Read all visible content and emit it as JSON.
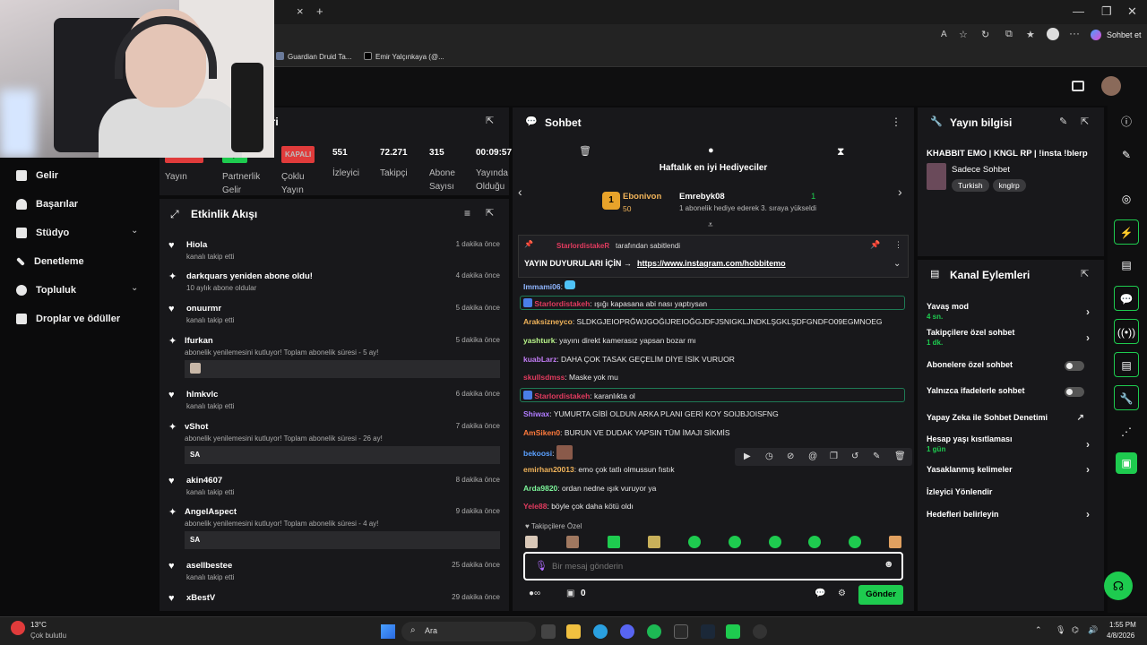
{
  "browser": {
    "tab_close": "×",
    "tab_new": "+",
    "window_controls": [
      "—",
      "❐",
      "✕"
    ],
    "chat_button": "Sohbet et",
    "bookmarks": [
      "Guardian Druid Ta...",
      "Emir Yalçınkaya (@..."
    ]
  },
  "leftnav": {
    "items": [
      "Gelir",
      "Başarılar",
      "Stüdyo",
      "Denetleme",
      "Topluluk",
      "Droplar ve ödüller"
    ]
  },
  "stats": {
    "title_fragment": "eri",
    "badges": [
      {
        "badge": "YAYINDA",
        "label": "Yayın",
        "color": "#e03b3b"
      },
      {
        "badge": "AÇIK",
        "label": "Partnerlik Gelir",
        "color": "#1ecb4f"
      },
      {
        "badge": "KAPALI",
        "label": "Çoklu Yayın",
        "color": "#e03b3b"
      }
    ],
    "numbers": [
      {
        "value": "551",
        "label": "İzleyici"
      },
      {
        "value": "72.271",
        "label": "Takipçi"
      },
      {
        "value": "315",
        "label": "Abone Sayısı"
      },
      {
        "value": "00:09:57",
        "label": "Yayında Olduğu Süre"
      }
    ]
  },
  "feed": {
    "title": "Etkinlik Akışı",
    "items": [
      {
        "name": "Hiola",
        "sub": "kanalı takip etti",
        "time": "1 dakika önce",
        "icon": "heart-icon"
      },
      {
        "name": "darkquars yeniden abone oldu!",
        "sub": "10 aylık abone oldular",
        "time": "4 dakika önce",
        "icon": "star-icon"
      },
      {
        "name": "onuurmr",
        "sub": "kanalı takip etti",
        "time": "5 dakika önce",
        "icon": "heart-icon"
      },
      {
        "name": "lfurkan",
        "sub": "abonelik yenilemesini kutluyor! Toplam abonelik süresi - 5 ay!",
        "time": "5 dakika önce",
        "icon": "star-icon",
        "msg": ""
      },
      {
        "name": "hlmkvlc",
        "sub": "kanalı takip etti",
        "time": "6 dakika önce",
        "icon": "heart-icon"
      },
      {
        "name": "vShot",
        "sub": "abonelik yenilemesini kutluyor! Toplam abonelik süresi - 26 ay!",
        "time": "7 dakika önce",
        "icon": "star-icon",
        "msg": "SA"
      },
      {
        "name": "akin4607",
        "sub": "kanalı takip etti",
        "time": "8 dakika önce",
        "icon": "heart-icon"
      },
      {
        "name": "AngelAspect",
        "sub": "abonelik yenilemesini kutluyor! Toplam abonelik süresi - 4 ay!",
        "time": "9 dakika önce",
        "icon": "star-icon",
        "msg": "SA"
      },
      {
        "name": "asellbestee",
        "sub": "kanalı takip etti",
        "time": "25 dakika önce",
        "icon": "heart-icon"
      },
      {
        "name": "xBestV",
        "sub": "",
        "time": "29 dakika önce",
        "icon": "heart-icon"
      }
    ]
  },
  "chat": {
    "title": "Sohbet",
    "gifters_title": "Haftalık en iyi Hediyeciler",
    "gifter1": {
      "rank": "1",
      "name": "Ebonivon",
      "amount": "50"
    },
    "gifter2": {
      "name": "Emrebyk08",
      "count": "1",
      "note": "1 abonelik hediye ederek 3. sıraya yükseldi"
    },
    "pinned_by": "StarlordistakeR",
    "pinned_suffix": "tarafından sabitlendi",
    "pinned_text": "YAYIN DUYURULARI İÇİN →",
    "pinned_link": "https://www.instagram.com/hobbitemo",
    "messages": [
      {
        "user": "Immami06",
        "text": ":",
        "color": "#8fb5ff",
        "mod": false
      },
      {
        "user": "Starlordistakeh",
        "text": ": ışığı kapasana abi nası yaptıysan",
        "color": "#e23b5f",
        "mod": true
      },
      {
        "user": "Araksizneyco",
        "text": ": SLDKGJEIOPRĞWJGOĞIJREIOĞGJDFJSNIGKLJNDKLŞGKLŞDFGNDFO09EGMNOEG",
        "color": "#f0b35a",
        "mod": false
      },
      {
        "user": "yashturk",
        "text": ": yayını direkt kamerasız yapsan bozar mı",
        "color": "#b9f58a",
        "mod": false
      },
      {
        "user": "kuabLarz",
        "text": ": DAHA ÇOK TASAK GEÇELİM DİYE İSİK VURUOR",
        "color": "#c27cf5",
        "mod": false
      },
      {
        "user": "skullsdmss",
        "text": ": Maske yok mu",
        "color": "#e23b5f",
        "mod": false
      },
      {
        "user": "Starlordistakeh",
        "text": ": karanlıkta ol",
        "color": "#e23b5f",
        "mod": true
      },
      {
        "user": "Shiwax",
        "text": ": YUMURTA GİBİ OLDUN ARKA PLANI GERİ KOY SOIJBJOISFNG",
        "color": "#b07cff",
        "mod": false
      },
      {
        "user": "AmSiken0",
        "text": ": BURUN VE DUDAK YAPSIN TÜM İMAJI SİKMİS",
        "color": "#ff7a3c",
        "mod": false
      },
      {
        "user": "bekoosi",
        "text": ":",
        "color": "#5aa0ff",
        "mod": false
      },
      {
        "user": "emirhan20013",
        "text": ": emo çok tatlı olmussun fıstık",
        "color": "#f0b35a",
        "mod": false
      },
      {
        "user": "Arda9820",
        "text": ": ordan nedne ışık vuruyor ya",
        "color": "#7cf59a",
        "mod": false
      },
      {
        "user": "Yele88",
        "text": ": böyle çok daha kötü oldı",
        "color": "#e23b5f",
        "mod": false
      }
    ],
    "followers_only": "Takipçilere Özel",
    "input_placeholder": "Bir mesaj gönderin",
    "bottom_count": "0",
    "send_label": "Gönder"
  },
  "info": {
    "title": "Yayın bilgisi",
    "stream_title": "KHABBIT EMO | KNGL RP | !insta !blerp",
    "category": "Sadece Sohbet",
    "tags": [
      "Turkish",
      "knglrp"
    ]
  },
  "actions": {
    "title": "Kanal Eylemleri",
    "items": [
      {
        "label": "Yavaş mod",
        "sub": "4 sn.",
        "control": "chevron"
      },
      {
        "label": "Takipçilere özel sohbet",
        "sub": "1 dk.",
        "control": "chevron"
      },
      {
        "label": "Abonelere özel sohbet",
        "sub": "",
        "control": "toggle"
      },
      {
        "label": "Yalnızca ifadelerle sohbet",
        "sub": "",
        "control": "toggle"
      },
      {
        "label": "Yapay Zeka ile Sohbet Denetimi",
        "sub": "",
        "control": "external"
      },
      {
        "label": "Hesap yaşı kısıtlaması",
        "sub": "1 gün",
        "control": "chevron"
      },
      {
        "label": "Yasaklanmış kelimeler",
        "sub": "",
        "control": "chevron"
      },
      {
        "label": "İzleyici Yönlendir",
        "sub": "",
        "control": "none"
      },
      {
        "label": "Hedefleri belirleyin",
        "sub": "",
        "control": "chevron"
      }
    ]
  },
  "taskbar": {
    "weather_temp": "13°C",
    "weather_desc": "Çok bulutlu",
    "search_placeholder": "Ara",
    "time": "1:55 PM",
    "date": "4/8/2026"
  },
  "colors": {
    "accent": "#1ecb4f",
    "live": "#e03b3b",
    "panel": "#18181b"
  }
}
